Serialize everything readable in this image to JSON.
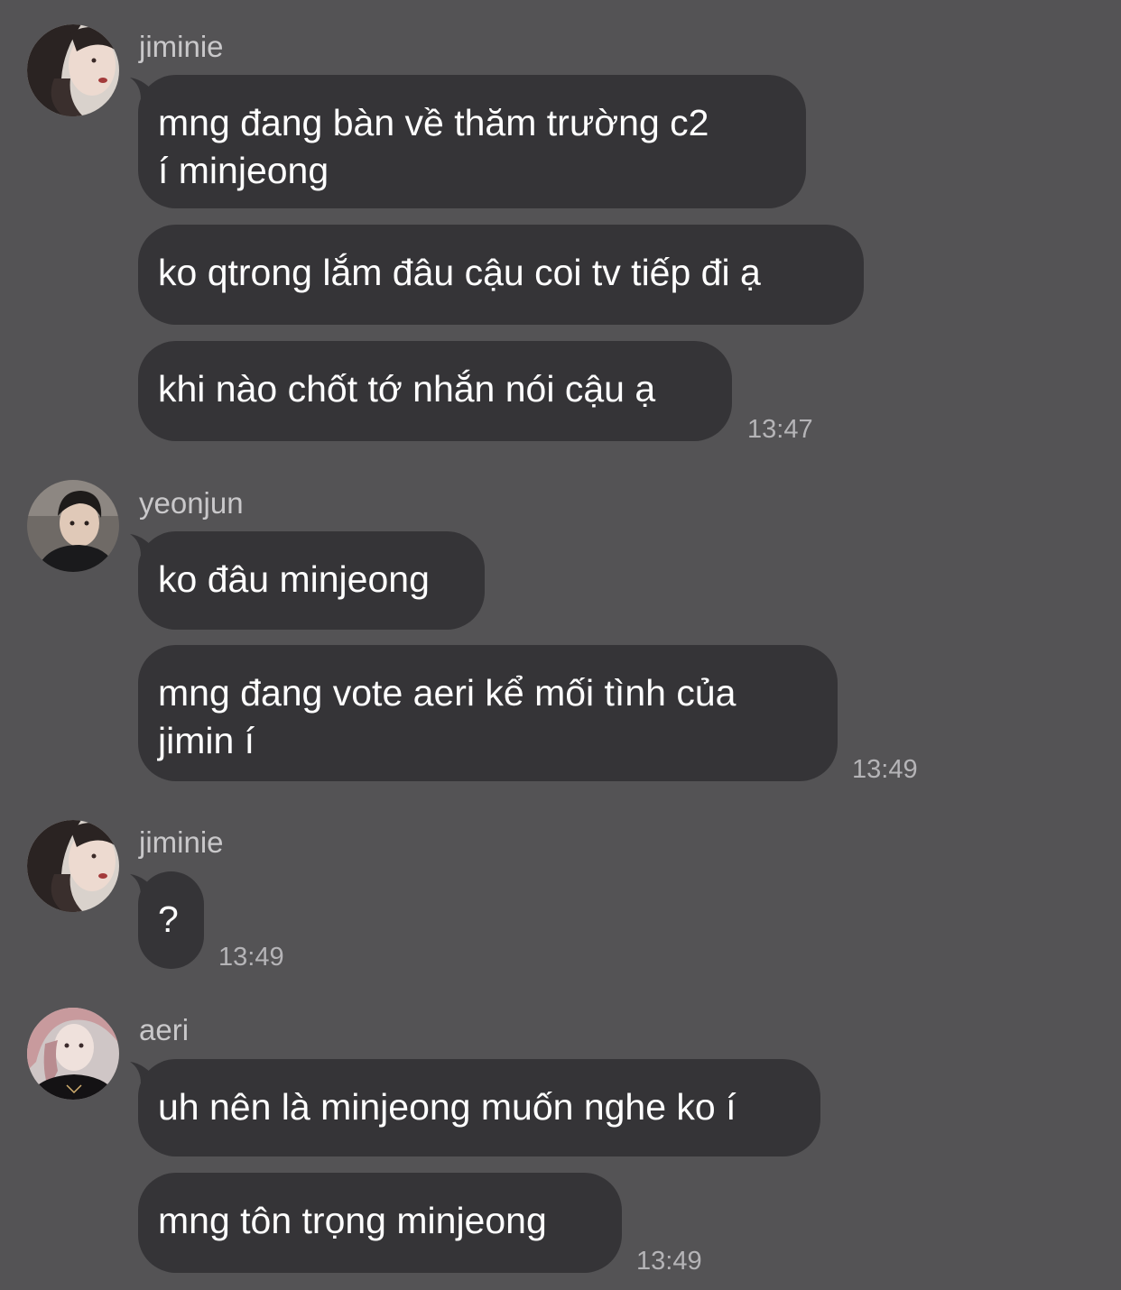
{
  "colors": {
    "background": "#545355",
    "bubble": "#353437",
    "message_text": "#ffffff",
    "sender_name": "#c9c8ca",
    "timestamp": "#b5b4b7"
  },
  "groups": [
    {
      "sender": "jiminie",
      "avatar": "avatar-jiminie",
      "messages": [
        "mng đang bàn về thăm trường c2\ní minjeong",
        "ko qtrong lắm đâu cậu coi tv tiếp đi ạ",
        "khi nào chốt tớ nhắn nói cậu ạ"
      ],
      "time": "13:47"
    },
    {
      "sender": "yeonjun",
      "avatar": "avatar-yeonjun",
      "messages": [
        "ko đâu minjeong",
        "mng đang vote aeri kể mối tình của\njimin í"
      ],
      "time": "13:49"
    },
    {
      "sender": "jiminie",
      "avatar": "avatar-jiminie",
      "messages": [
        "?"
      ],
      "time": "13:49"
    },
    {
      "sender": "aeri",
      "avatar": "avatar-aeri",
      "messages": [
        "uh nên là minjeong muốn nghe ko í",
        "mng tôn trọng minjeong"
      ],
      "time": "13:49"
    }
  ]
}
